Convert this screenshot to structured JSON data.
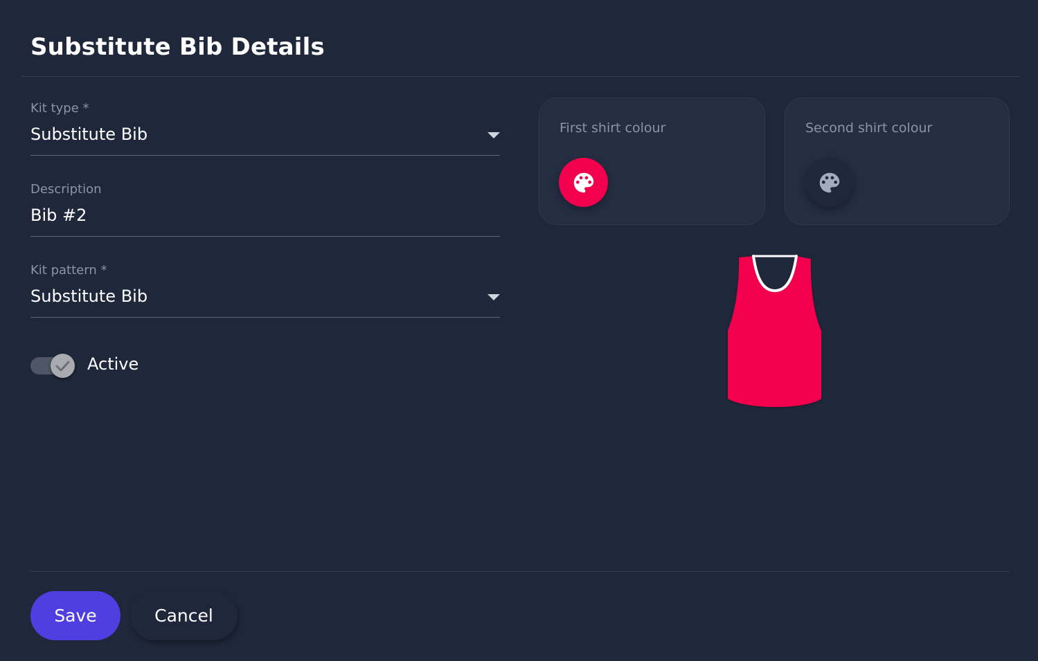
{
  "header": {
    "title": "Substitute Bib Details"
  },
  "form": {
    "kit_type": {
      "label": "Kit type *",
      "value": "Substitute Bib"
    },
    "description": {
      "label": "Description",
      "value": "Bib #2"
    },
    "kit_pattern": {
      "label": "Kit pattern *",
      "value": "Substitute Bib"
    },
    "active": {
      "label": "Active",
      "checked": true
    }
  },
  "colours": {
    "first": {
      "label": "First shirt colour",
      "value": "#f2004e",
      "icon": "palette-icon"
    },
    "second": {
      "label": "Second shirt colour",
      "value": "",
      "icon": "palette-icon"
    }
  },
  "preview": {
    "shirt_colour": "#f2004e",
    "trim_colour": "#ffffff"
  },
  "actions": {
    "save_label": "Save",
    "cancel_label": "Cancel"
  }
}
